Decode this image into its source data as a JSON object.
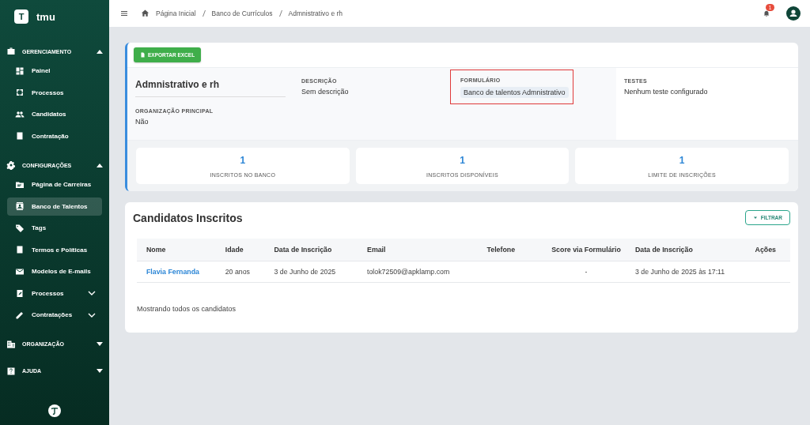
{
  "brand": {
    "logo_letter": "T",
    "name": "tmu"
  },
  "sidebar": [
    {
      "kind": "section",
      "label": "GERENCIAMENTO",
      "expanded": true,
      "items": [
        {
          "kind": "link",
          "label": "Painel",
          "selected": false
        },
        {
          "kind": "link",
          "label": "Processos",
          "selected": false
        },
        {
          "kind": "link",
          "label": "Candidatos",
          "selected": false
        },
        {
          "kind": "link",
          "label": "Contratação",
          "selected": false
        }
      ]
    },
    {
      "kind": "section",
      "label": "CONFIGURAÇÕES",
      "expanded": true,
      "items": [
        {
          "kind": "link",
          "label": "Página de Carreiras",
          "selected": false
        },
        {
          "kind": "link",
          "label": "Banco de Talentos",
          "selected": true
        },
        {
          "kind": "link",
          "label": "Tags",
          "selected": false
        },
        {
          "kind": "link",
          "label": "Termos e Políticas",
          "selected": false
        },
        {
          "kind": "link",
          "label": "Modelos de E-mails",
          "selected": false
        },
        {
          "kind": "group",
          "label": "Processos",
          "selected": false
        },
        {
          "kind": "group",
          "label": "Contratações",
          "selected": false
        }
      ]
    },
    {
      "kind": "section",
      "label": "ORGANIZAÇÃO",
      "expanded": false
    },
    {
      "kind": "section",
      "label": "AJUDA",
      "expanded": false
    }
  ],
  "breadcrumb": [
    "Página Inicial",
    "Banco de Currículos",
    "Admnistrativo e rh"
  ],
  "notifications": {
    "count": "1"
  },
  "export_button": "EXPORTAR EXCEL",
  "bank": {
    "name": "Admnistrativo e rh",
    "fields": [
      {
        "label": "DESCRIÇÃO",
        "value": "Sem descrição",
        "kind": "text",
        "highlighted": false
      },
      {
        "label": "FORMULÁRIO",
        "value": "Banco de talentos Admnistrativo",
        "kind": "chip",
        "highlighted": true
      },
      {
        "label": "TESTES",
        "value": "Nenhum teste configurado",
        "kind": "text",
        "highlighted": false
      }
    ],
    "org_label": "ORGANIZAÇÃO PRINCIPAL",
    "org_value": "Não"
  },
  "stats": [
    {
      "value": "1",
      "label": "INSCRITOS NO BANCO"
    },
    {
      "value": "1",
      "label": "INSCRITOS DISPONÍVEIS"
    },
    {
      "value": "1",
      "label": "LIMITE DE INSCRIÇÕES"
    }
  ],
  "candidates": {
    "title": "Candidatos Inscritos",
    "filter_button": "FILTRAR",
    "columns": [
      "Nome",
      "Idade",
      "Data de Inscrição",
      "Email",
      "Telefone",
      "Score via Formulário",
      "Data de Inscrição",
      "Ações"
    ],
    "rows": [
      [
        "Flavia Fernanda",
        "20 anos",
        "3 de Junho de 2025",
        "tolok72509@apklamp.com",
        "",
        "-",
        "3 de Junho de 2025 às 17:11",
        ""
      ]
    ],
    "footer": "Mostrando todos os candidatos"
  }
}
